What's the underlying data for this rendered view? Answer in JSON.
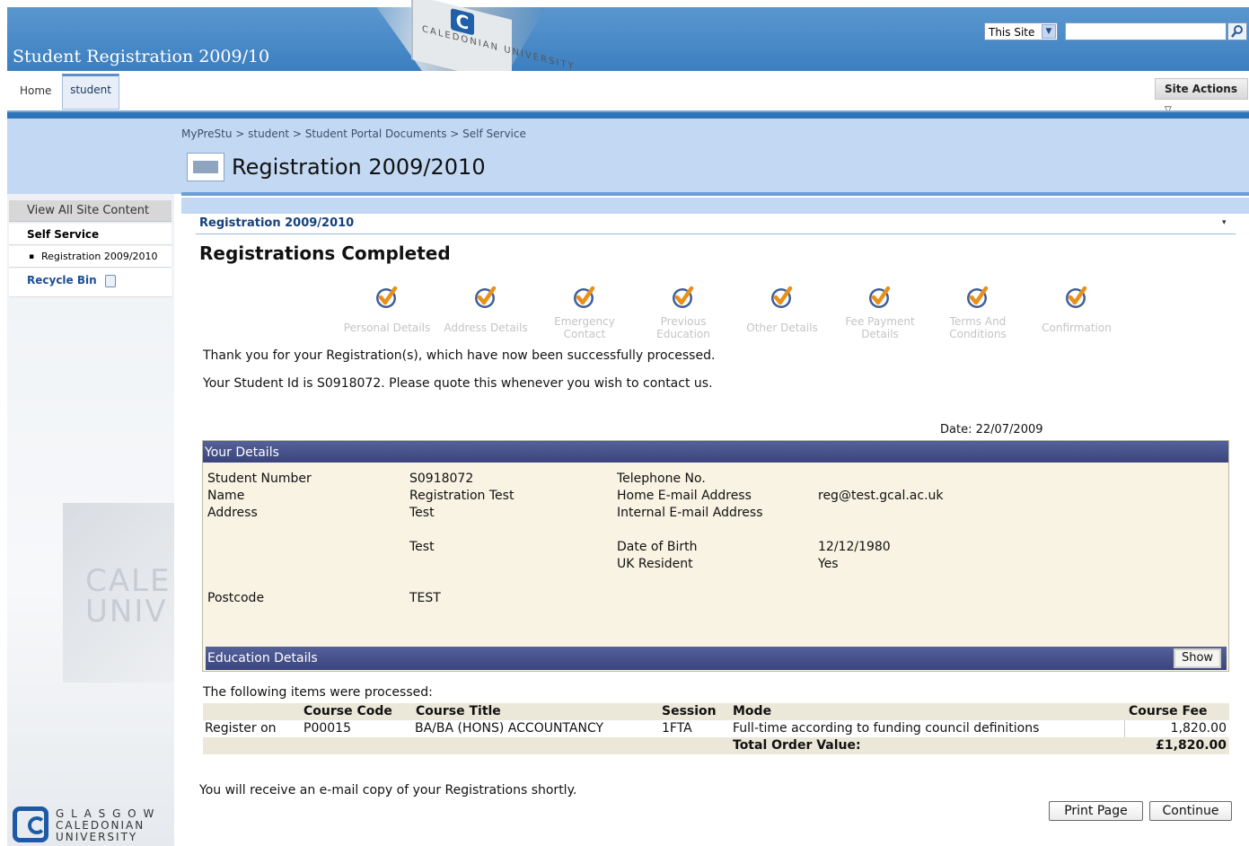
{
  "header": {
    "site_title": "Student Registration 2009/10",
    "banner_sign_text": "CALEDONIAN UNIVERSITY",
    "search_scope": "This Site",
    "search_placeholder": ""
  },
  "top_nav": {
    "tabs": [
      {
        "label": "Home"
      },
      {
        "label": "student"
      }
    ],
    "site_actions": "Site Actions",
    "site_actions_arrow": "▽"
  },
  "breadcrumb": "MyPreStu > student > Student Portal Documents > Self Service",
  "page_title": "Registration 2009/2010",
  "left_nav": {
    "view_all": "View All Site Content",
    "section": "Self Service",
    "item": "Registration 2009/2010",
    "recycle_bin": "Recycle Bin"
  },
  "webpart": {
    "title": "Registration 2009/2010",
    "menu_arrow": "▾",
    "heading": "Registrations Completed"
  },
  "steps": [
    {
      "label": "Personal Details"
    },
    {
      "label": "Address Details"
    },
    {
      "label": "Emergency Contact"
    },
    {
      "label": "Previous Education"
    },
    {
      "label": "Other Details"
    },
    {
      "label": "Fee Payment Details"
    },
    {
      "label": "Terms And Conditions"
    },
    {
      "label": "Confirmation"
    }
  ],
  "messages": {
    "thanks": "Thank you for your Registration(s), which have now been successfully processed.",
    "student_id": "Your Student Id is S0918072. Please quote this whenever you wish to contact us.",
    "date": "Date: 22/07/2009",
    "processed": "The following items were processed:",
    "email_copy": "You will receive an e-mail copy of your Registrations shortly."
  },
  "your_details": {
    "heading": "Your Details",
    "student_number_label": "Student Number",
    "student_number": "S0918072",
    "name_label": "Name",
    "name": "Registration Test",
    "address_label": "Address",
    "address_line1": "Test",
    "address_line2": "Test",
    "postcode_label": "Postcode",
    "postcode": "TEST",
    "telephone_label": "Telephone No.",
    "telephone": "",
    "home_email_label": "Home E-mail Address",
    "home_email": "reg@test.gcal.ac.uk",
    "internal_email_label": "Internal E-mail Address",
    "internal_email": "",
    "dob_label": "Date of Birth",
    "dob": "12/12/1980",
    "uk_resident_label": "UK Resident",
    "uk_resident": "Yes"
  },
  "education": {
    "heading": "Education Details",
    "show_button": "Show"
  },
  "items_table": {
    "headers": {
      "course_code": "Course Code",
      "course_title": "Course Title",
      "session": "Session",
      "mode": "Mode",
      "course_fee": "Course Fee"
    },
    "row": {
      "action": "Register on",
      "course_code": "P00015",
      "course_title": "BA/BA (HONS) ACCOUNTANCY",
      "session": "1FTA",
      "mode": "Full-time according to funding council definitions",
      "course_fee": "1,820.00"
    },
    "total_label": "Total Order Value:",
    "total_value": "£1,820.00"
  },
  "buttons": {
    "print": "Print Page",
    "continue": "Continue"
  },
  "footer_logo": {
    "line1": "G L A S G O W",
    "line2": "CALEDONIAN",
    "line3": "UNIVERSITY"
  },
  "colors": {
    "header_blue": "#3c7fc0",
    "title_band": "#c3d9f3",
    "detail_header": "#3b447d",
    "detail_bg": "#f8f3e3",
    "check_orange": "#e8901a"
  }
}
